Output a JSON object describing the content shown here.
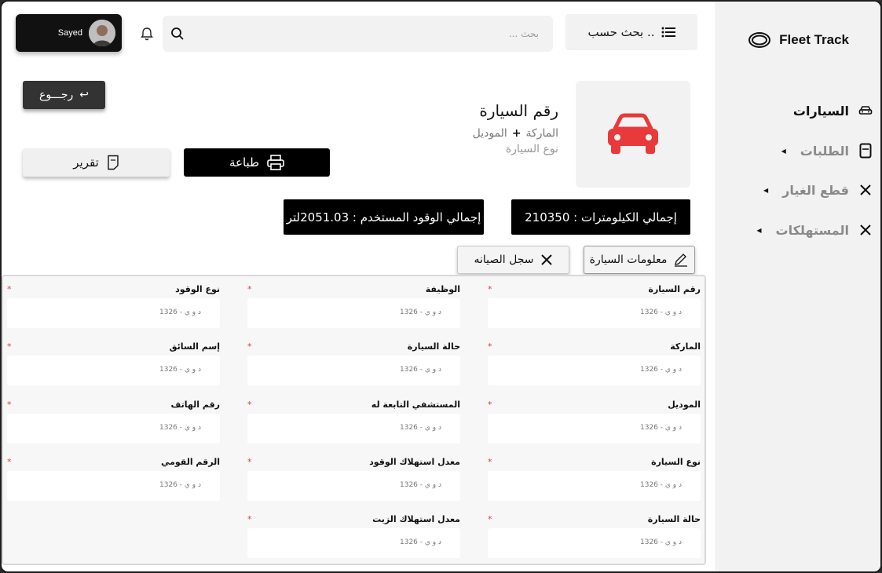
{
  "app": {
    "brand": "Fleet Track"
  },
  "user": {
    "name": "Sayed"
  },
  "search": {
    "placeholder": "بحث ...",
    "by_label": "بحث حسب .."
  },
  "sidebar": {
    "items": [
      {
        "label": "السيارات",
        "icon": "car-icon",
        "active": true
      },
      {
        "label": "الطلبات",
        "icon": "document-icon",
        "active": false
      },
      {
        "label": "قطع الغيار",
        "icon": "tools-icon",
        "active": false
      },
      {
        "label": "المستهلكات",
        "icon": "tools-icon",
        "active": false
      }
    ]
  },
  "back_label": "رجـــوع",
  "car": {
    "title": "رقم السيارة",
    "brand": "الماركة",
    "plus": "+",
    "model": "الموديل",
    "type": "نوع السيارة"
  },
  "actions": {
    "print_label": "طباعة",
    "report_label": "تقرير"
  },
  "stats": {
    "km": "إجمالي الكيلومترات : 210350",
    "fuel": "إجمالي الوقود المستخدم : 2051.03لتر"
  },
  "tabs": {
    "info": "معلومات السيارة",
    "maintenance": "سجل الصيانه"
  },
  "form": {
    "required_mark": "*",
    "value_text": "د و ي - 1326",
    "columns": [
      [
        "رقم السيارة",
        "الماركة",
        "الموديل",
        "نوع السيارة",
        "حالة السيارة"
      ],
      [
        "الوظيفة",
        "حالة السيارة",
        "المستشفي التابعة له",
        "معدل استهلاك الوقود",
        "معدل استهلاك الزيت"
      ],
      [
        "نوع الوقود",
        "إسم السائق",
        "رقم الهاتف",
        "الرقم القومي"
      ]
    ]
  },
  "colors": {
    "accent_red": "#e83a3a",
    "dark": "#000000",
    "sidebar_bg": "#f2f2f2"
  }
}
